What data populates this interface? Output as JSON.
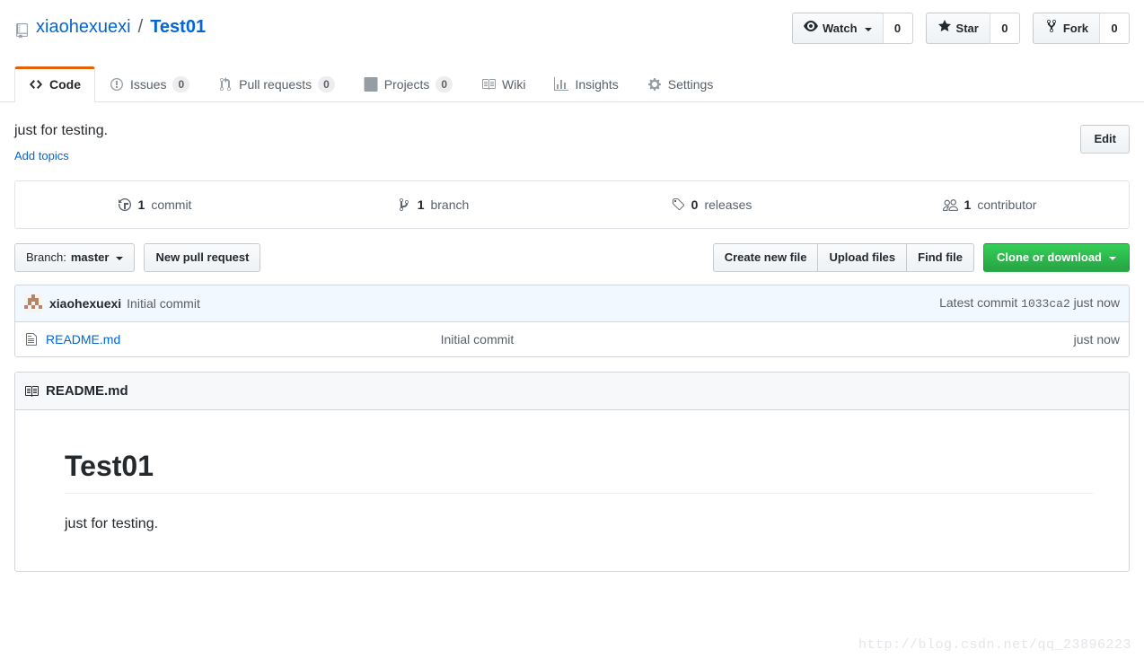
{
  "repo": {
    "icon": "repo-icon",
    "owner": "xiaohexuexi",
    "separator": "/",
    "name": "Test01"
  },
  "social": {
    "watch": {
      "icon": "eye-icon",
      "label": "Watch",
      "count": "0"
    },
    "star": {
      "icon": "star-icon",
      "label": "Star",
      "count": "0"
    },
    "fork": {
      "icon": "fork-icon",
      "label": "Fork",
      "count": "0"
    }
  },
  "nav": {
    "tabs": [
      {
        "id": "code",
        "icon": "code-icon",
        "label": "Code",
        "count": null,
        "active": true
      },
      {
        "id": "issues",
        "icon": "issue-opened-icon",
        "label": "Issues",
        "count": "0",
        "active": false
      },
      {
        "id": "pull-requests",
        "icon": "git-pull-request-icon",
        "label": "Pull requests",
        "count": "0",
        "active": false
      },
      {
        "id": "projects",
        "icon": "project-board-icon",
        "label": "Projects",
        "count": "0",
        "active": false
      },
      {
        "id": "wiki",
        "icon": "book-icon",
        "label": "Wiki",
        "count": null,
        "active": false
      },
      {
        "id": "insights",
        "icon": "graph-icon",
        "label": "Insights",
        "count": null,
        "active": false
      },
      {
        "id": "settings",
        "icon": "gear-icon",
        "label": "Settings",
        "count": null,
        "active": false
      }
    ]
  },
  "about": {
    "description": "just for testing.",
    "add_topics_label": "Add topics",
    "edit_label": "Edit"
  },
  "overview": {
    "items": [
      {
        "id": "commits",
        "icon": "history-icon",
        "number": "1",
        "label": "commit"
      },
      {
        "id": "branches",
        "icon": "branch-icon",
        "number": "1",
        "label": "branch"
      },
      {
        "id": "releases",
        "icon": "tag-icon",
        "number": "0",
        "label": "releases"
      },
      {
        "id": "contributors",
        "icon": "people-icon",
        "number": "1",
        "label": "contributor"
      }
    ]
  },
  "toolbar": {
    "branch_prefix": "Branch:",
    "branch_name": "master",
    "new_pull_request": "New pull request",
    "create_new_file": "Create new file",
    "upload_files": "Upload files",
    "find_file": "Find file",
    "clone_or_download": "Clone or download"
  },
  "latest_commit": {
    "avatar": "identicon-avatar",
    "author": "xiaohexuexi",
    "message": "Initial commit",
    "meta_prefix": "Latest commit",
    "sha": "1033ca2",
    "age": "just now"
  },
  "files": {
    "rows": [
      {
        "icon": "file-icon",
        "name": "README.md",
        "message": "Initial commit",
        "age": "just now"
      }
    ]
  },
  "readme": {
    "icon": "book-icon",
    "title": "README.md",
    "heading": "Test01",
    "paragraph": "just for testing."
  },
  "watermark": {
    "text": "http://blog.csdn.net/qq_23896223"
  },
  "colors": {
    "accent_blue": "#0366d6",
    "active_tab_border": "#e36209",
    "green_button": "#28a745",
    "commit_row_bg": "#f1f8ff",
    "border": "#d1d5da"
  }
}
